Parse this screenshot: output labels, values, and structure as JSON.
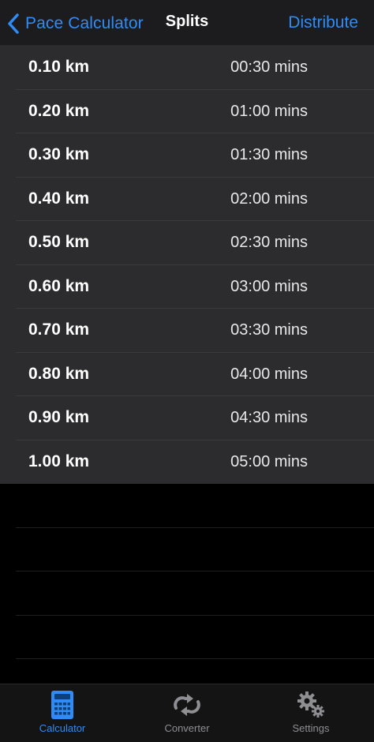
{
  "nav": {
    "back_label": "Pace Calculator",
    "title": "Splits",
    "action_label": "Distribute"
  },
  "splits": [
    {
      "distance": "0.10 km",
      "time": "00:30 mins"
    },
    {
      "distance": "0.20 km",
      "time": "01:00 mins"
    },
    {
      "distance": "0.30 km",
      "time": "01:30 mins"
    },
    {
      "distance": "0.40 km",
      "time": "02:00 mins"
    },
    {
      "distance": "0.50 km",
      "time": "02:30 mins"
    },
    {
      "distance": "0.60 km",
      "time": "03:00 mins"
    },
    {
      "distance": "0.70 km",
      "time": "03:30 mins"
    },
    {
      "distance": "0.80 km",
      "time": "04:00 mins"
    },
    {
      "distance": "0.90 km",
      "time": "04:30 mins"
    },
    {
      "distance": "1.00 km",
      "time": "05:00 mins"
    }
  ],
  "tabs": [
    {
      "label": "Calculator",
      "icon": "calculator-icon",
      "active": true
    },
    {
      "label": "Converter",
      "icon": "converter-icon",
      "active": false
    },
    {
      "label": "Settings",
      "icon": "gears-icon",
      "active": false
    }
  ],
  "colors": {
    "accent": "#2f8cf6",
    "background": "#000000",
    "navbar": "#1c1c1e",
    "list_row": "#2c2c2e",
    "inactive_tab": "#8e8e93"
  }
}
